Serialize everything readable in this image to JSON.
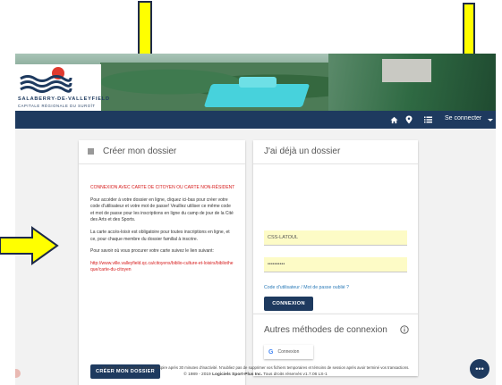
{
  "brand": {
    "name": "SALABERRY-DE-VALLEYFIELD",
    "subtitle": "CAPITALE RÉGIONALE DU SUROÎT"
  },
  "nav": {
    "icons": [
      "home-icon",
      "map-pin-icon",
      "list-icon"
    ],
    "login_label": "Se connecter"
  },
  "create_card": {
    "title": "Créer mon dossier",
    "notice": "CONNEXION AVEC CARTE DE CITOYEN OU CARTE NON-RÉSIDENT",
    "paragraph1": "Pour accéder à votre dossier en ligne, cliquez ici-bas pour créer votre code d'utilisateur et votre mot de passe! Veuillez utiliser ce même code et mot de passe pour les inscriptions en ligne du camp de jour de la Cité des Arts et des Sports.",
    "paragraph2": "La carte accès-loisir est obligatoire pour toutes inscriptions en ligne, et ce, pour chaque membre du dossier familial à inscrire.",
    "paragraph3": "Pour savoir où vous procurer votre carte suivez le lien suivant:",
    "link": "http://www.ville.valleyfield.qc.ca/citoyens/biblio-culture-et-loisirs/bibliotheque/carte-du-citoyen",
    "button": "CRÉER MON DOSSIER"
  },
  "login_card": {
    "title": "J'ai déjà un dossier",
    "username_value": "CSS-LATOUL",
    "username_placeholder": "Code d'utilisateur",
    "password_value": "••••••••••",
    "password_placeholder": "Mot de passe",
    "forgot_link": "Code d'utilisateur / Mot de passe oublié ?",
    "button": "CONNEXION",
    "other_methods_title": "Autres méthodes de connexion",
    "google_button": "Connexion",
    "google_letter": "G"
  },
  "footer": {
    "notice": "Veuillez noter que votre session expire après 30 minutes d'inactivité. N'oubliez pas de supprimer vos fichiers temporaires et témoins de session après avoir terminé vos transactions.",
    "copyright_prefix": "© 1989 - 2019",
    "company": "Logiciels Sport-Plus Inc.",
    "rights": "Tous droits réservés v1.7.06 LS-1"
  },
  "fab_label": "•••",
  "colors": {
    "navy": "#1e3a5f",
    "notice_red": "#d61a1a",
    "field_yellow": "#fdfbc6",
    "annotation_yellow": "#ffff00"
  }
}
